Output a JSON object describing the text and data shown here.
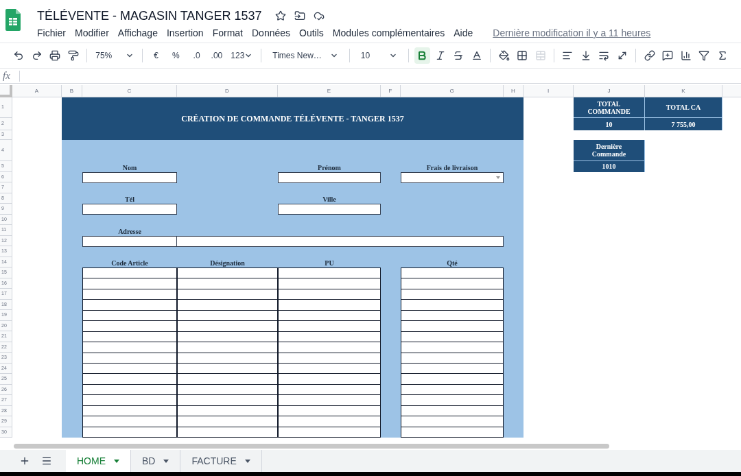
{
  "app": {
    "title": "TÉLÉVENTE - MAGASIN TANGER 1537",
    "menu": [
      "Fichier",
      "Modifier",
      "Affichage",
      "Insertion",
      "Format",
      "Données",
      "Outils",
      "Modules complémentaires",
      "Aide"
    ],
    "last_modified": "Dernière modification il y a 11 heures"
  },
  "toolbar": {
    "zoom": "75%",
    "currency": "€",
    "percent": "%",
    "decimals_decrease": ".0",
    "decimals_increase": ".00",
    "number_format": "123",
    "font": "Times New…",
    "font_size": "10",
    "bold_active": true
  },
  "formula_bar": {
    "label": "fx"
  },
  "sheet": {
    "column_headers": [
      "A",
      "B",
      "C",
      "D",
      "E",
      "F",
      "G",
      "H",
      "I",
      "J",
      "K"
    ],
    "row_headers": [
      "1",
      "2",
      "3",
      "4",
      "5",
      "6",
      "7",
      "8",
      "9",
      "10",
      "11",
      "12",
      "13",
      "14",
      "15",
      "16",
      "17",
      "18",
      "19",
      "20",
      "21",
      "22",
      "23",
      "24",
      "25",
      "26",
      "27",
      "28",
      "29",
      "30"
    ],
    "form": {
      "title": "CRÉATION DE COMMANDE TÉLÉVENTE - TANGER 1537",
      "fields": [
        {
          "label": "Nom",
          "kind": "text"
        },
        {
          "label": "Prénom",
          "kind": "text"
        },
        {
          "label": "Frais de livraison",
          "kind": "dropdown"
        },
        {
          "label": "Tél",
          "kind": "text"
        },
        {
          "label": "Ville",
          "kind": "text"
        },
        {
          "label": "Adresse",
          "kind": "address"
        }
      ],
      "order_table": {
        "columns": [
          "Code Article",
          "Désignation",
          "PU",
          "Qté"
        ]
      }
    },
    "summary": [
      {
        "label": "TOTAL COMMANDE",
        "value": "10"
      },
      {
        "label": "TOTAL CA",
        "value": "7 755,00"
      },
      {
        "label": "Dernière Commande",
        "value": "1010"
      }
    ]
  },
  "sheet_tabs": [
    {
      "label": "HOME",
      "selected": true
    },
    {
      "label": "BD",
      "selected": false
    },
    {
      "label": "FACTURE",
      "selected": false
    }
  ]
}
